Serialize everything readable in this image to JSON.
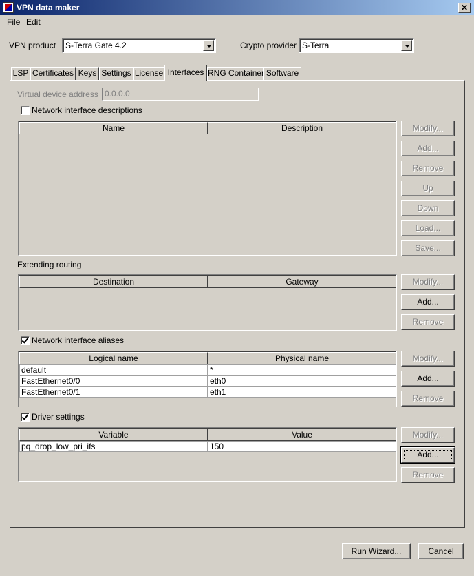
{
  "window": {
    "title": "VPN data maker",
    "close_glyph": "✕"
  },
  "menu": [
    "File",
    "Edit"
  ],
  "vpn_product": {
    "label": "VPN product",
    "value": "S-Terra Gate 4.2"
  },
  "crypto_provider": {
    "label": "Crypto provider",
    "value": "S-Terra"
  },
  "tabs": [
    "LSP",
    "Certificates",
    "Keys",
    "Settings",
    "License",
    "Interfaces",
    "RNG Container",
    "Software"
  ],
  "active_tab": "Interfaces",
  "virtual_device": {
    "label": "Virtual device address",
    "value": "0.0.0.0"
  },
  "nid": {
    "checkbox_label": "Network interface descriptions",
    "checked": false,
    "columns": [
      "Name",
      "Description"
    ],
    "buttons": [
      "Modify...",
      "Add...",
      "Remove",
      "Up",
      "Down",
      "Load...",
      "Save..."
    ]
  },
  "routing": {
    "label": "Extending routing",
    "columns": [
      "Destination",
      "Gateway"
    ],
    "buttons": [
      "Modify...",
      "Add...",
      "Remove"
    ]
  },
  "aliases": {
    "checkbox_label": "Network interface aliases",
    "checked": true,
    "columns": [
      "Logical name",
      "Physical name"
    ],
    "rows": [
      [
        "default",
        "*"
      ],
      [
        "FastEthernet0/0",
        "eth0"
      ],
      [
        "FastEthernet0/1",
        "eth1"
      ]
    ],
    "buttons": [
      "Modify...",
      "Add...",
      "Remove"
    ]
  },
  "driver": {
    "checkbox_label": "Driver settings",
    "checked": true,
    "columns": [
      "Variable",
      "Value"
    ],
    "rows": [
      [
        "pq_drop_low_pri_ifs",
        "150"
      ]
    ],
    "buttons": [
      "Modify...",
      "Add...",
      "Remove"
    ]
  },
  "footer": {
    "run_wizard": "Run Wizard...",
    "cancel": "Cancel"
  }
}
